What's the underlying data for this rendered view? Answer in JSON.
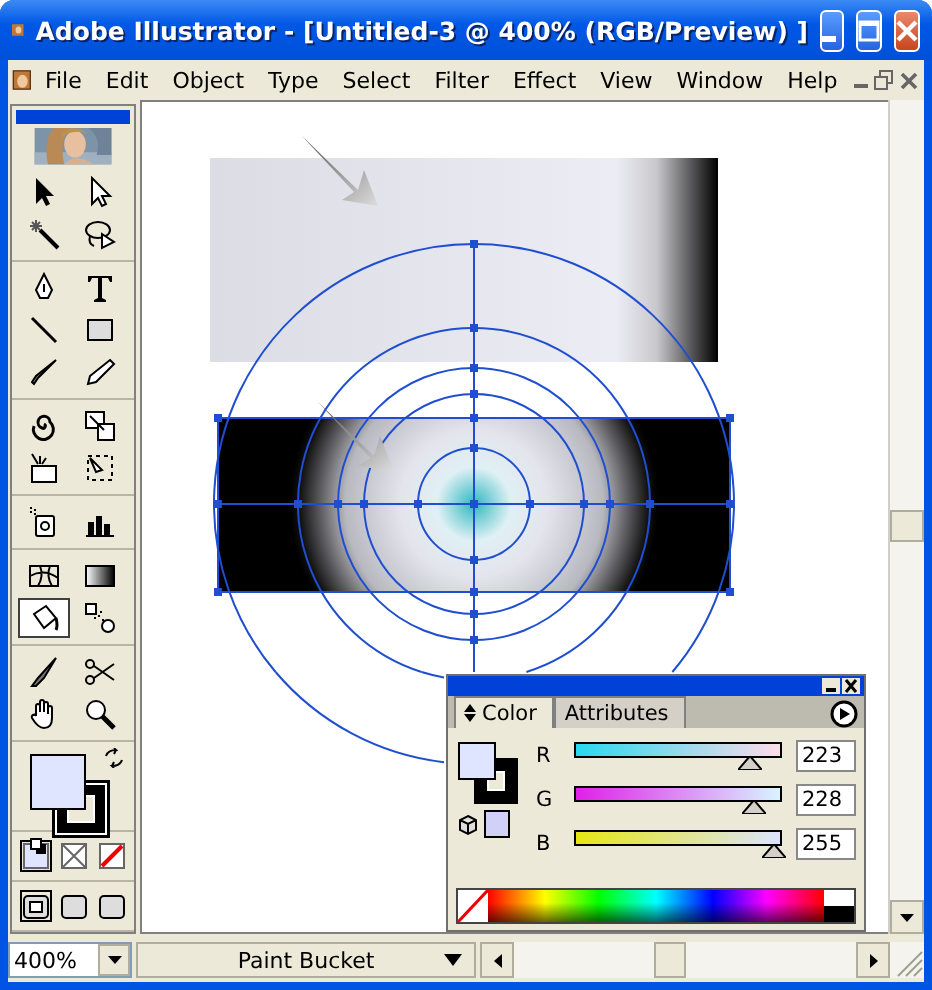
{
  "window": {
    "title": "Adobe Illustrator - [Untitled-3 @ 400% (RGB/Preview) ]"
  },
  "menu": [
    "File",
    "Edit",
    "Object",
    "Type",
    "Select",
    "Filter",
    "Effect",
    "View",
    "Window",
    "Help"
  ],
  "toolbox": {
    "groups": [
      [
        {
          "selected": false
        },
        {
          "selected": false
        },
        {
          "selected": false
        },
        {
          "selected": false
        }
      ],
      [
        {
          "selected": false
        },
        {
          "selected": false
        },
        {
          "selected": false
        },
        {
          "selected": false
        },
        {
          "selected": false
        },
        {
          "selected": false
        }
      ],
      [
        {
          "selected": false
        },
        {
          "selected": false
        },
        {
          "selected": false
        },
        {
          "selected": false
        }
      ],
      [
        {
          "selected": false
        },
        {
          "selected": false
        }
      ],
      [
        {
          "selected": false
        },
        {
          "selected": false
        },
        {
          "selected": true
        },
        {
          "selected": false
        }
      ],
      [
        {
          "selected": false
        },
        {
          "selected": false
        },
        {
          "selected": false
        },
        {
          "selected": false
        }
      ]
    ],
    "paint_modes": [
      {
        "selected": true
      },
      {
        "selected": false
      },
      {
        "selected": false
      }
    ],
    "screen_modes": [
      {
        "selected": true
      },
      {
        "selected": false
      },
      {
        "selected": false
      }
    ]
  },
  "color_panel": {
    "tabs": [
      {
        "label": "Color",
        "selected": true
      },
      {
        "label": "Attributes",
        "selected": false
      }
    ],
    "channels": [
      {
        "label": "R",
        "value": "223",
        "level": 0.875
      },
      {
        "label": "G",
        "value": "228",
        "level": 0.894
      },
      {
        "label": "B",
        "value": "255",
        "level": 1.0
      }
    ]
  },
  "status_bar": {
    "zoom": "400%",
    "tool": "Paint Bucket"
  }
}
